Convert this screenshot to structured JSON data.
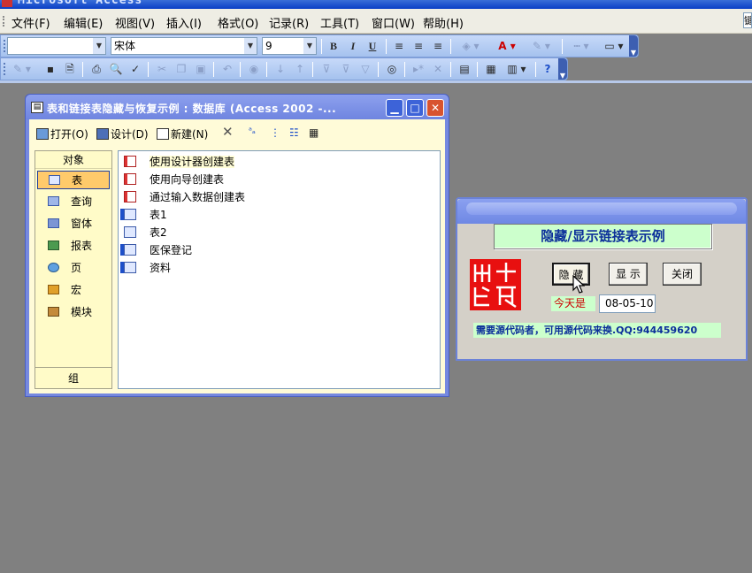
{
  "app": {
    "title": "Microsoft Access"
  },
  "menu": {
    "items": [
      "文件(F)",
      "编辑(E)",
      "视图(V)",
      "插入(I)",
      "格式(O)",
      "记录(R)",
      "工具(T)",
      "窗口(W)",
      "帮助(H)"
    ],
    "help_box": "键"
  },
  "format_toolbar": {
    "object_combo": "",
    "font_combo": "宋体",
    "size_combo": "9",
    "bold": "B",
    "italic": "I",
    "underline": "U"
  },
  "db_window": {
    "title": "表和链接表隐藏与恢复示例 : 数据库 (Access 2002 -...",
    "toolbar": {
      "open": "打开(O)",
      "design": "设计(D)",
      "new": "新建(N)"
    },
    "objects_header": "对象",
    "objects": [
      {
        "label": "表",
        "icon": "table-icon"
      },
      {
        "label": "查询",
        "icon": "query-icon"
      },
      {
        "label": "窗体",
        "icon": "form-icon"
      },
      {
        "label": "报表",
        "icon": "report-icon"
      },
      {
        "label": "页",
        "icon": "page-icon"
      },
      {
        "label": "宏",
        "icon": "macro-icon"
      },
      {
        "label": "模块",
        "icon": "module-icon"
      }
    ],
    "groups_label": "组",
    "list": [
      {
        "label": "使用设计器创建表",
        "icon": "wizard-icon"
      },
      {
        "label": "使用向导创建表",
        "icon": "wizard-icon"
      },
      {
        "label": "通过输入数据创建表",
        "icon": "wizard-icon"
      },
      {
        "label": "表1",
        "icon": "linked-table-icon"
      },
      {
        "label": "表2",
        "icon": "table-icon"
      },
      {
        "label": "医保登记",
        "icon": "linked-table-icon"
      },
      {
        "label": "资料",
        "icon": "linked-table-icon"
      }
    ]
  },
  "form": {
    "heading": "隐藏/显示链接表示例",
    "seal_text": "出十段",
    "hide_button": "隐 藏",
    "show_button": "显 示",
    "close_button": "关闭",
    "today_label": "今天是",
    "date_value": "08-05-10",
    "note": "需要源代码者，可用源代码来换.QQ:944459620"
  },
  "colors": {
    "titlebar": "#6f85e0",
    "db_background": "#fffbd8",
    "selection": "#ffca6b",
    "form_label_bg": "#ccffcc",
    "seal": "#e81010"
  }
}
